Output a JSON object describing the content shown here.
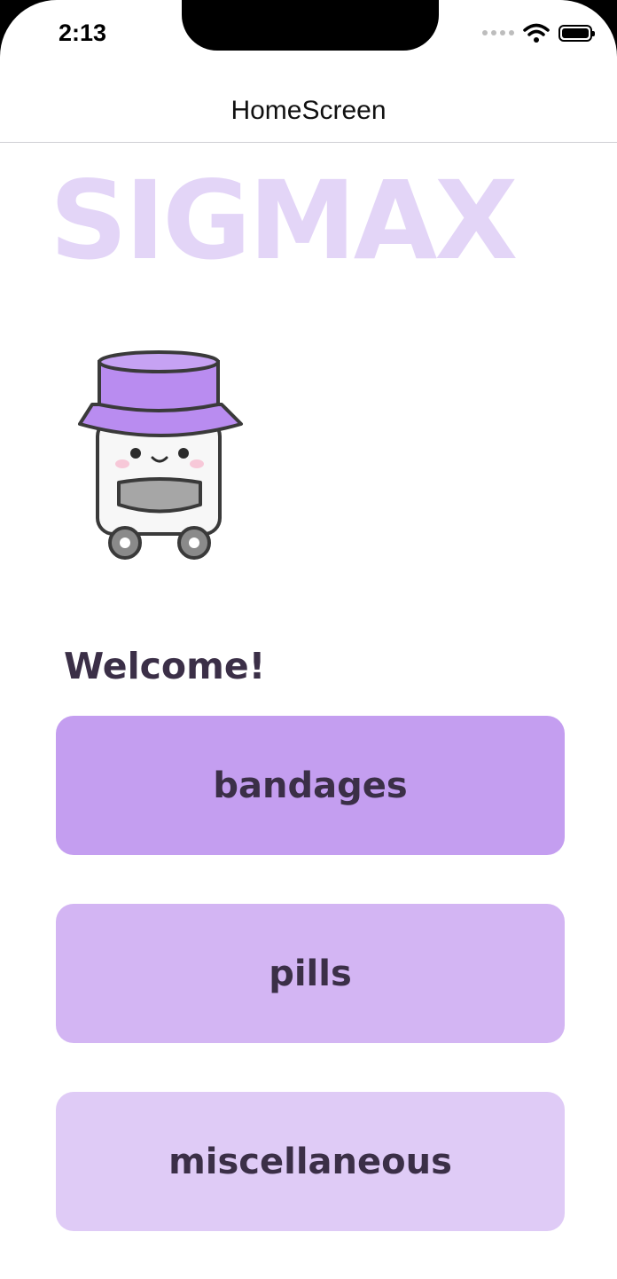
{
  "status_bar": {
    "time": "2:13"
  },
  "nav": {
    "title": "HomeScreen"
  },
  "logo": {
    "text": "SIGMAX"
  },
  "welcome": {
    "text": "Welcome!"
  },
  "buttons": [
    {
      "label": "bandages",
      "color": "#c49ef0"
    },
    {
      "label": "pills",
      "color": "#d3b5f3"
    },
    {
      "label": "miscellaneous",
      "color": "#dfcbf6"
    }
  ],
  "colors": {
    "logo": "#e3d5f7",
    "text_dark": "#3b2f47",
    "mascot_lid": "#b98cf0"
  },
  "icons": [
    "cellular-dots-icon",
    "wifi-icon",
    "battery-icon",
    "mascot-pill-bottle"
  ]
}
